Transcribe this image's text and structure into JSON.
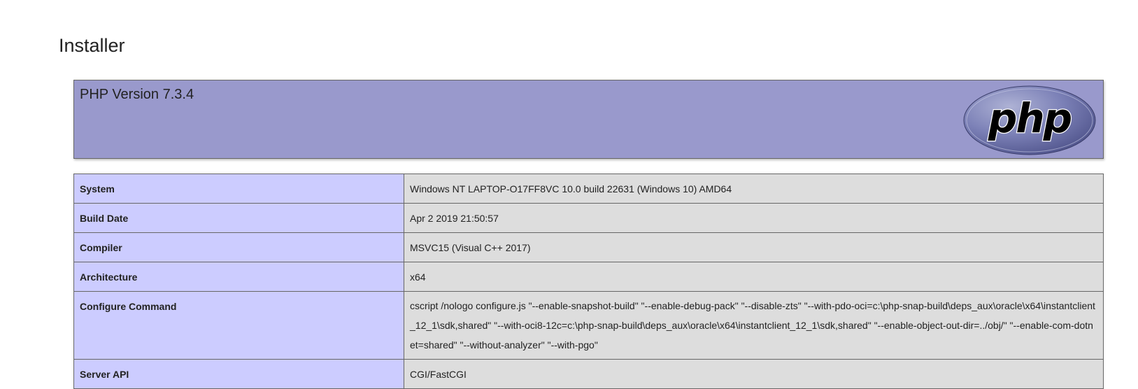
{
  "page": {
    "title": "Installer"
  },
  "php_header": {
    "version_label": "PHP Version 7.3.4",
    "logo_text": "php",
    "colors": {
      "header_bg": "#9999cc",
      "key_bg": "#ccccff",
      "value_bg": "#dddddd",
      "logo_oval": "#6c71a6",
      "border": "#666666"
    }
  },
  "info": {
    "rows": [
      {
        "key": "System",
        "value": "Windows NT LAPTOP-O17FF8VC 10.0 build 22631 (Windows 10) AMD64"
      },
      {
        "key": "Build Date",
        "value": "Apr 2 2019 21:50:57"
      },
      {
        "key": "Compiler",
        "value": "MSVC15 (Visual C++ 2017)"
      },
      {
        "key": "Architecture",
        "value": "x64"
      },
      {
        "key": "Configure Command",
        "value": "cscript /nologo configure.js \"--enable-snapshot-build\" \"--enable-debug-pack\" \"--disable-zts\" \"--with-pdo-oci=c:\\php-snap-build\\deps_aux\\oracle\\x64\\instantclient_12_1\\sdk,shared\" \"--with-oci8-12c=c:\\php-snap-build\\deps_aux\\oracle\\x64\\instantclient_12_1\\sdk,shared\" \"--enable-object-out-dir=../obj/\" \"--enable-com-dotnet=shared\" \"--without-analyzer\" \"--with-pgo\""
      },
      {
        "key": "Server API",
        "value": "CGI/FastCGI"
      }
    ]
  }
}
